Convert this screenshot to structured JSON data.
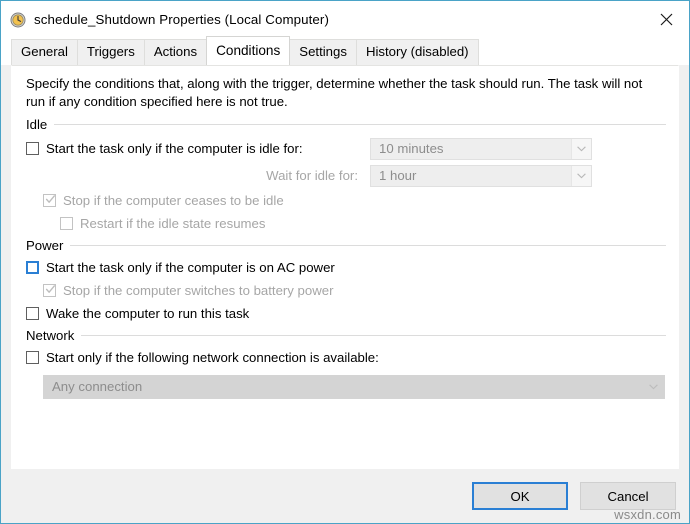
{
  "window": {
    "title": "schedule_Shutdown Properties (Local Computer)",
    "icon": "clock-icon",
    "close_label": "✕",
    "border_color": "#4aa3c7"
  },
  "tabs": [
    {
      "label": "General",
      "active": false
    },
    {
      "label": "Triggers",
      "active": false
    },
    {
      "label": "Actions",
      "active": false
    },
    {
      "label": "Conditions",
      "active": true
    },
    {
      "label": "Settings",
      "active": false
    },
    {
      "label": "History (disabled)",
      "active": false
    }
  ],
  "description": "Specify the conditions that, along with the trigger, determine whether the task should run.  The task will not run  if any condition specified here is not true.",
  "groups": {
    "idle": {
      "title": "Idle",
      "start_if_idle": {
        "label": "Start the task only if the computer is idle for:",
        "checked": false,
        "disabled": false
      },
      "idle_duration": {
        "value": "10 minutes",
        "disabled": true
      },
      "wait_for_idle_label": "Wait for idle for:",
      "wait_duration": {
        "value": "1 hour",
        "disabled": true
      },
      "stop_if_ceases_idle": {
        "label": "Stop if the computer ceases to be idle",
        "checked": true,
        "disabled": true
      },
      "restart_if_idle_resumes": {
        "label": "Restart if the idle state resumes",
        "checked": false,
        "disabled": true
      }
    },
    "power": {
      "title": "Power",
      "start_if_ac": {
        "label": "Start the task only if the computer is on AC power",
        "checked": false,
        "disabled": false,
        "focused": true
      },
      "stop_if_battery": {
        "label": "Stop if the computer switches to battery power",
        "checked": true,
        "disabled": true
      },
      "wake_computer": {
        "label": "Wake the computer to run this task",
        "checked": false,
        "disabled": false
      }
    },
    "network": {
      "title": "Network",
      "start_if_network": {
        "label": "Start only if the following network connection is available:",
        "checked": false,
        "disabled": false
      },
      "connection": {
        "value": "Any connection",
        "disabled": true
      }
    }
  },
  "footer": {
    "ok_label": "OK",
    "cancel_label": "Cancel",
    "default_button": "OK",
    "accent_color": "#2a7fd4"
  },
  "watermark": "wsxdn.com"
}
